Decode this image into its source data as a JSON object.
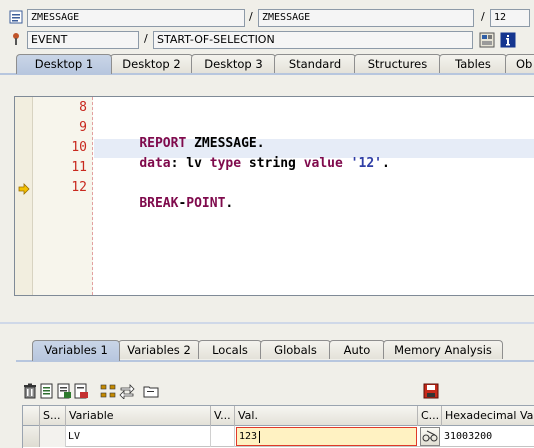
{
  "header": {
    "program": "ZMESSAGE",
    "include": "ZMESSAGE",
    "line": "12",
    "event_type": "EVENT",
    "event_name": "START-OF-SELECTION"
  },
  "desktop_tabs": [
    "Desktop 1",
    "Desktop 2",
    "Desktop 3",
    "Standard",
    "Structures",
    "Tables",
    "Ob"
  ],
  "code_lines": [
    {
      "num": "8",
      "text": ""
    },
    {
      "num": "9",
      "text": "REPORT ZMESSAGE."
    },
    {
      "num": "10",
      "text": "data: lv type string value '12'."
    },
    {
      "num": "11",
      "text": ""
    },
    {
      "num": "12",
      "text": "BREAK-POINT."
    }
  ],
  "code_tokens": {
    "report_kw": "REPORT",
    "report_name": " ZMESSAGE.",
    "data_kw": "data",
    "colon": ": lv ",
    "type_kw": "type",
    "string_word": " string ",
    "value_kw": "value",
    "literal": " '12'",
    "period": ".",
    "break_kw": "BREAK",
    "dash": "-",
    "point_kw": "POINT",
    "break_end": "."
  },
  "variable_tabs": [
    "Variables 1",
    "Variables 2",
    "Locals",
    "Globals",
    "Auto",
    "Memory Analysis"
  ],
  "table": {
    "headers": [
      "S...",
      "Variable",
      "V...",
      "Val.",
      "C...",
      "Hexadecimal Valu"
    ],
    "rows": [
      {
        "variable": "LV",
        "value": "123",
        "hex": "31003200"
      }
    ]
  },
  "colors": {
    "keyword": "#7f0a4c",
    "literal": "#2f3ea6",
    "line_number": "#c8281e",
    "current_line_highlight": "#e6ecf7",
    "active_tab": "#b7c6de",
    "edit_cell": "#fff2c2"
  }
}
